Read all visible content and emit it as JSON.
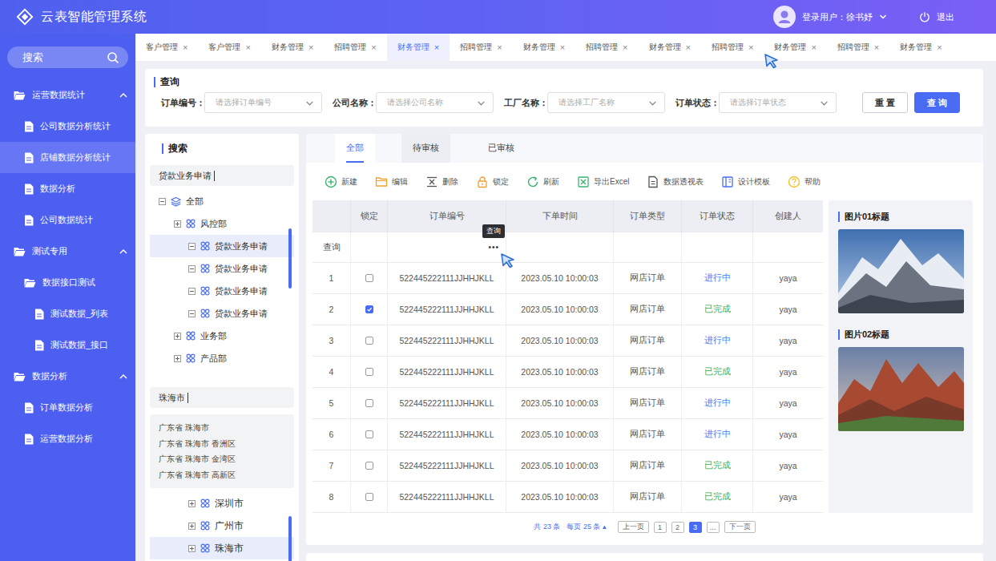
{
  "header": {
    "title": "云表智能管理系统",
    "user_label": "登录用户：徐书妤",
    "logout": "退出"
  },
  "sidebar": {
    "search_placeholder": "搜索",
    "items": [
      {
        "label": "运营数据统计",
        "kind": "group",
        "level": 0,
        "expanded": true,
        "selected": false
      },
      {
        "label": "公司数据分析统计",
        "kind": "page",
        "level": 1,
        "expanded": false,
        "selected": false
      },
      {
        "label": "店铺数据分析统计",
        "kind": "page",
        "level": 1,
        "expanded": false,
        "selected": true
      },
      {
        "label": "数据分析",
        "kind": "page",
        "level": 1,
        "expanded": false,
        "selected": false
      },
      {
        "label": "公司数据统计",
        "kind": "page",
        "level": 1,
        "expanded": false,
        "selected": false
      },
      {
        "label": "测试专用",
        "kind": "group",
        "level": 0,
        "expanded": true,
        "selected": false
      },
      {
        "label": "数据接口测试",
        "kind": "folder",
        "level": 1,
        "expanded": true,
        "selected": false
      },
      {
        "label": "测试数据_列表",
        "kind": "page",
        "level": 2,
        "expanded": false,
        "selected": false
      },
      {
        "label": "测试数据_接口",
        "kind": "page",
        "level": 2,
        "expanded": false,
        "selected": false
      },
      {
        "label": "数据分析",
        "kind": "group",
        "level": 0,
        "expanded": true,
        "selected": false
      },
      {
        "label": "订单数据分析",
        "kind": "page",
        "level": 1,
        "expanded": false,
        "selected": false
      },
      {
        "label": "运营数据分析",
        "kind": "page",
        "level": 1,
        "expanded": false,
        "selected": false
      }
    ]
  },
  "page_tabs": [
    {
      "label": "客户管理",
      "close": "×",
      "selected": false
    },
    {
      "label": "客户管理",
      "close": "×",
      "selected": false
    },
    {
      "label": "财务管理",
      "close": "×",
      "selected": false
    },
    {
      "label": "招聘管理",
      "close": "×",
      "selected": false
    },
    {
      "label": "财务管理",
      "close": "×",
      "selected": true
    },
    {
      "label": "招聘管理",
      "close": "×",
      "selected": false
    },
    {
      "label": "财务管理",
      "close": "×",
      "selected": false
    },
    {
      "label": "招聘管理",
      "close": "×",
      "selected": false
    },
    {
      "label": "财务管理",
      "close": "×",
      "selected": false
    },
    {
      "label": "招聘管理",
      "close": "×",
      "selected": false
    },
    {
      "label": "财务管理",
      "close": "×",
      "selected": false
    },
    {
      "label": "招聘管理",
      "close": "×",
      "selected": false
    },
    {
      "label": "财务管理",
      "close": "×",
      "selected": false
    }
  ],
  "query": {
    "title": "查询",
    "fields": [
      {
        "label": "订单编号：",
        "placeholder": "请选择订单编号"
      },
      {
        "label": "公司名称：",
        "placeholder": "请选择公司名称"
      },
      {
        "label": "工厂名称：",
        "placeholder": "请选择工厂名称"
      },
      {
        "label": "订单状态：",
        "placeholder": "请选择订单状态"
      }
    ],
    "buttons": [
      {
        "label": "重 置",
        "primary": false
      },
      {
        "label": "查 询",
        "primary": true
      }
    ]
  },
  "search_panel": {
    "title": "搜索",
    "tree_search": "贷款业务申请",
    "tree": [
      {
        "label": "全部",
        "level": 0,
        "expanded": true,
        "kind": "root",
        "selected": false
      },
      {
        "label": "风控部",
        "level": 1,
        "expanded": false,
        "kind": "node",
        "selected": false
      },
      {
        "label": "贷款业务申请",
        "level": 2,
        "expanded": true,
        "kind": "node",
        "selected": true
      },
      {
        "label": "贷款业务申请",
        "level": 2,
        "expanded": true,
        "kind": "node",
        "selected": false
      },
      {
        "label": "贷款业务申请",
        "level": 2,
        "expanded": true,
        "kind": "node",
        "selected": false
      },
      {
        "label": "贷款业务申请",
        "level": 2,
        "expanded": true,
        "kind": "node",
        "selected": false
      },
      {
        "label": "业务部",
        "level": 1,
        "expanded": false,
        "kind": "node",
        "selected": false
      },
      {
        "label": "产品部",
        "level": 1,
        "expanded": false,
        "kind": "node",
        "selected": false
      }
    ],
    "region_search": "珠海市",
    "suggestions": [
      "广东省 珠海市",
      "广东省 珠海市 香洲区",
      "广东省 珠海市 金湾区",
      "广东省 珠海市 高新区"
    ],
    "region_tree": [
      {
        "label": "深圳市",
        "level": 2,
        "expanded": false,
        "kind": "node",
        "selected": false
      },
      {
        "label": "广州市",
        "level": 2,
        "expanded": false,
        "kind": "node",
        "selected": false
      },
      {
        "label": "珠海市",
        "level": 2,
        "expanded": false,
        "kind": "node",
        "selected": true
      }
    ]
  },
  "content_tabs": [
    {
      "label": "全部",
      "selected": true,
      "hovered": false
    },
    {
      "label": "待审核",
      "selected": false,
      "hovered": true
    },
    {
      "label": "已审核",
      "selected": false,
      "hovered": false
    }
  ],
  "toolbar": [
    {
      "label": "新建",
      "color": "#3cb371"
    },
    {
      "label": "编辑",
      "color": "#f0a030"
    },
    {
      "label": "删除",
      "color": "#555555"
    },
    {
      "label": "锁定",
      "color": "#f0a030"
    },
    {
      "label": "刷新",
      "color": "#3cb371"
    },
    {
      "label": "导出Excel",
      "color": "#3cb371"
    },
    {
      "label": "数据透视表",
      "color": "#555555"
    },
    {
      "label": "设计模板",
      "color": "#4a6cf5"
    },
    {
      "label": "帮助",
      "color": "#f5c030"
    }
  ],
  "table": {
    "columns": [
      "",
      "锁定",
      "订单编号",
      "下单时间",
      "订单类型",
      "订单状态",
      "创建人"
    ],
    "filter_row": {
      "label": "查询",
      "ellipsis": "•••",
      "tooltip": "查询"
    },
    "rows": [
      {
        "no": "1",
        "locked": false,
        "order_no": "522445222111JJHHJKLL",
        "time": "2023.05.10 10:00:03",
        "type": "网店订单",
        "status": "进行中",
        "color": "#4a7cf5",
        "creator": "yaya"
      },
      {
        "no": "2",
        "locked": true,
        "order_no": "522445222111JJHHJKLL",
        "time": "2023.05.10 10:00:03",
        "type": "网店订单",
        "status": "已完成",
        "color": "#2fb05a",
        "creator": "yaya"
      },
      {
        "no": "3",
        "locked": false,
        "order_no": "522445222111JJHHJKLL",
        "time": "2023.05.10 10:00:03",
        "type": "网店订单",
        "status": "进行中",
        "color": "#4a7cf5",
        "creator": "yaya"
      },
      {
        "no": "4",
        "locked": false,
        "order_no": "522445222111JJHHJKLL",
        "time": "2023.05.10 10:00:03",
        "type": "网店订单",
        "status": "已完成",
        "color": "#2fb05a",
        "creator": "yaya"
      },
      {
        "no": "5",
        "locked": false,
        "order_no": "522445222111JJHHJKLL",
        "time": "2023.05.10 10:00:03",
        "type": "网店订单",
        "status": "进行中",
        "color": "#4a7cf5",
        "creator": "yaya"
      },
      {
        "no": "6",
        "locked": false,
        "order_no": "522445222111JJHHJKLL",
        "time": "2023.05.10 10:00:03",
        "type": "网店订单",
        "status": "进行中",
        "color": "#4a7cf5",
        "creator": "yaya"
      },
      {
        "no": "7",
        "locked": false,
        "order_no": "522445222111JJHHJKLL",
        "time": "2023.05.10 10:00:03",
        "type": "网店订单",
        "status": "已完成",
        "color": "#2fb05a",
        "creator": "yaya"
      },
      {
        "no": "8",
        "locked": false,
        "order_no": "522445222111JJHHJKLL",
        "time": "2023.05.10 10:00:03",
        "type": "网店订单",
        "status": "已完成",
        "color": "#2fb05a",
        "creator": "yaya"
      }
    ]
  },
  "gallery": [
    {
      "title": "图片01标题"
    },
    {
      "title": "图片02标题"
    }
  ],
  "pagination": {
    "total": "共 23 条",
    "page_size": "每页 25 条 ▴",
    "prev": "上一页",
    "pages": [
      {
        "label": "1",
        "selected": false
      },
      {
        "label": "2",
        "selected": false
      },
      {
        "label": "3",
        "selected": true
      }
    ],
    "ellipsis": "...",
    "next": "下一页"
  }
}
